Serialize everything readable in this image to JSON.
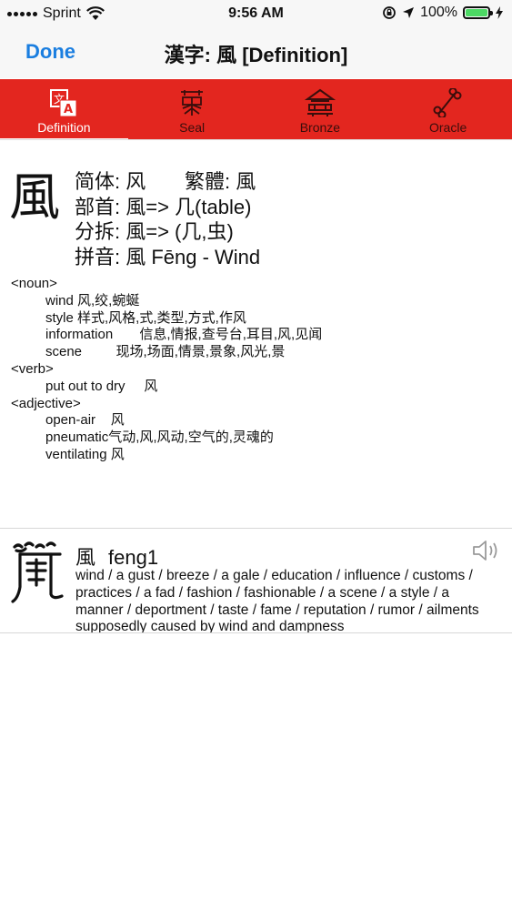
{
  "status": {
    "carrier": "Sprint",
    "time": "9:56 AM",
    "battery": "100%",
    "battery_level": 1.0
  },
  "nav": {
    "done_label": "Done",
    "title": "漢字: 風 [Definition]"
  },
  "tabs": [
    {
      "label": "Definition",
      "icon": "translate-icon",
      "active": true
    },
    {
      "label": "Seal",
      "icon": "seal-script-icon",
      "active": false
    },
    {
      "label": "Bronze",
      "icon": "bronze-script-icon",
      "active": false
    },
    {
      "label": "Oracle",
      "icon": "oracle-bone-icon",
      "active": false
    }
  ],
  "entry": {
    "character": "風",
    "simplified_line": "简体: 风       繁體: 風",
    "radical_line": "部首: 風=> 几(table)",
    "decompose_line": "分拆: 風=> (几,虫)",
    "pinyin_line": "拼音: 風 Fēng - Wind",
    "definitions": [
      {
        "type": "pos",
        "text": "<noun>"
      },
      {
        "type": "sense",
        "text": "wind 风,绞,蜿蜒"
      },
      {
        "type": "sense",
        "text": "style 样式,风格,式,类型,方式,作风"
      },
      {
        "type": "sense",
        "text": "information       信息,情报,查号台,耳目,风,见闻"
      },
      {
        "type": "sense",
        "text": "scene         现场,场面,情景,景象,风光,景"
      },
      {
        "type": "pos",
        "text": "<verb>"
      },
      {
        "type": "sense",
        "text": "put out to dry     风"
      },
      {
        "type": "pos",
        "text": "<adjective>"
      },
      {
        "type": "sense",
        "text": "open-air    风"
      },
      {
        "type": "sense",
        "text": "pneumatic气动,风,风动,空气的,灵魂的"
      },
      {
        "type": "sense",
        "text": "ventilating 风"
      }
    ]
  },
  "dictionary": {
    "char": "風",
    "pinyin": "feng1",
    "meaning": "wind / a gust / breeze / a gale / education / influence / customs / practices / a fad / fashion / fashionable / a scene / a style / a manner / deportment / taste / fame / reputation / rumor / ailments supposedly caused by wind and dampness"
  },
  "colors": {
    "accent": "#1a7ee0",
    "tab_bar": "#e3261f",
    "tab_inactive_text": "#3a0e0c"
  }
}
